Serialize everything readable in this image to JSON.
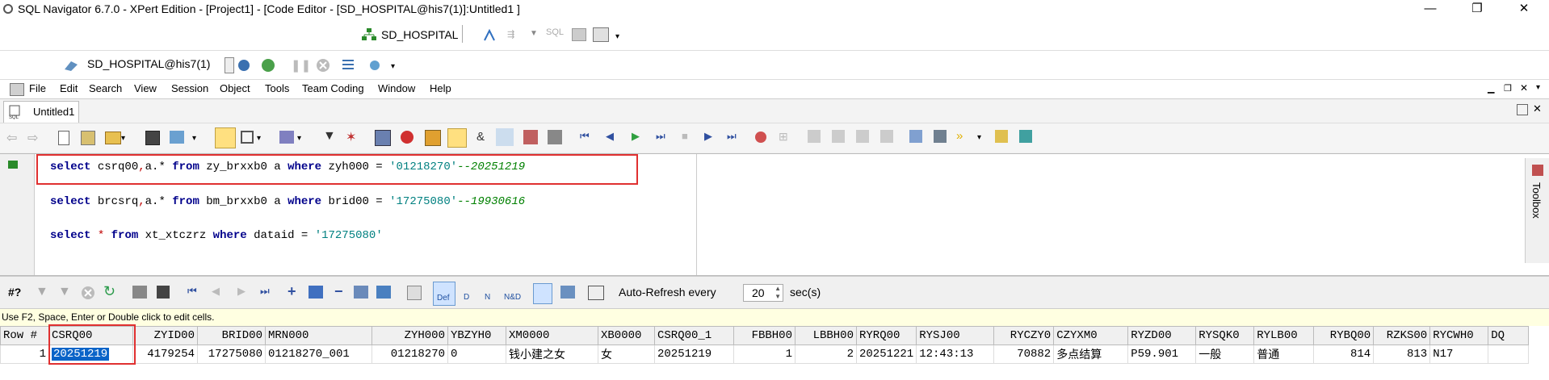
{
  "window": {
    "title": "SQL Navigator 6.7.0 - XPert Edition - [Project1] - [Code Editor - [SD_HOSPITAL@his7(1)]:Untitled1 ]",
    "minimize": "—",
    "restore": "❐",
    "close": "✕"
  },
  "toolbar_top": {
    "connection": "SD_HOSPITAL"
  },
  "toolbar_session": {
    "session": "SD_HOSPITAL@his7(1)"
  },
  "menu": [
    "File",
    "Edit",
    "Search",
    "View",
    "Session",
    "Object",
    "Tools",
    "Team Coding",
    "Window",
    "Help"
  ],
  "tab": {
    "label": "Untitled1"
  },
  "editor": {
    "lines": [
      {
        "kw1": "select",
        "mid1": " csrq00",
        "op": ",",
        "mid2": "a.* ",
        "kw2": "from",
        "mid3": " zy_brxxb0 a ",
        "kw3": "where",
        "mid4": " zyh000 = ",
        "str": "'01218270'",
        "cmt": "--20251219"
      },
      {
        "kw1": "select",
        "mid1": " brcsrq",
        "op": ",",
        "mid2": "a.* ",
        "kw2": "from",
        "mid3": " bm_brxxb0 a ",
        "kw3": "where",
        "mid4": " brid00 = ",
        "str": "'17275080'",
        "cmt": "--19930616"
      },
      {
        "kw1": "select",
        "mid1": " ",
        "op": "*",
        "mid2": " ",
        "kw2": "from",
        "mid3": " xt_xtczrz ",
        "kw3": "where",
        "mid4": " dataid = ",
        "str": "'17275080'",
        "cmt": ""
      }
    ],
    "toolbox_label": "Toolbox"
  },
  "grid_toolbar": {
    "rowcount_label": "#?",
    "def": "Def",
    "d": "D",
    "n": "N",
    "nd": "N&D",
    "auto_refresh_label": "Auto-Refresh every",
    "auto_refresh_value": "20",
    "secs_label": "sec(s)"
  },
  "hint": "Use F2, Space, Enter or Double click to edit cells.",
  "grid": {
    "columns": [
      "Row #",
      "CSRQ00",
      "ZYID00",
      "BRID00",
      "MRN000",
      "ZYH000",
      "YBZYH0",
      "XM0000",
      "XB0000",
      "CSRQ00_1",
      "FBBH00",
      "LBBH00",
      "RYRQ00",
      "RYSJ00",
      "RYCZY0",
      "CZYXM0",
      "RYZD00",
      "RYSQK0",
      "RYLB00",
      "RYBQ00",
      "RZKS00",
      "RYCWH0",
      "DQ"
    ],
    "rows": [
      [
        "1",
        "20251219",
        "4179254",
        "17275080",
        "01218270_001",
        "01218270",
        "0",
        "钱小建之女",
        "女",
        "20251219",
        "1",
        "2",
        "20251221",
        "12:43:13",
        "70882",
        "多点结算",
        "P59.901",
        "一般",
        "普通",
        "814",
        "813",
        "N17",
        ""
      ]
    ]
  }
}
